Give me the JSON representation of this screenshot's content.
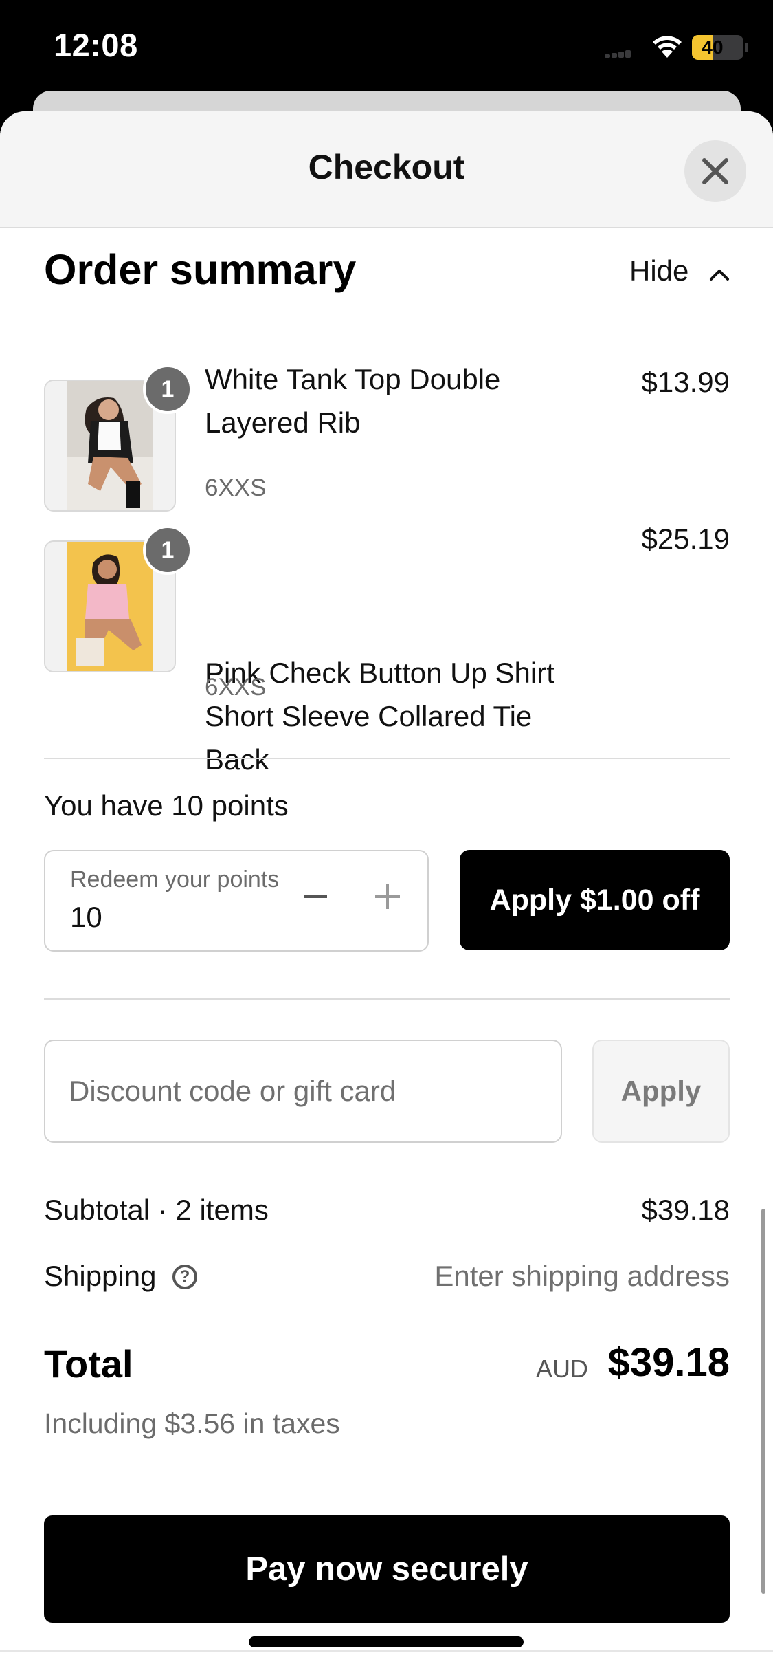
{
  "status_bar": {
    "time": "12:08",
    "battery_level": "40",
    "battery_percent": 40
  },
  "header": {
    "title": "Checkout"
  },
  "order_summary": {
    "title": "Order summary",
    "toggle_label": "Hide",
    "items": [
      {
        "quantity": "1",
        "name": "White Tank Top Double Layered Rib",
        "variant": "6XXS",
        "price": "$13.99"
      },
      {
        "quantity": "1",
        "name": "Pink Check Button Up Shirt Short Sleeve Collared Tie Back",
        "variant": "6XXS",
        "price": "$25.19"
      }
    ]
  },
  "points": {
    "text": "You have 10 points",
    "input_label": "Redeem your points",
    "input_value": "10",
    "apply_label": "Apply $1.00 off"
  },
  "discount": {
    "placeholder": "Discount code or gift card",
    "apply_label": "Apply"
  },
  "totals": {
    "subtotal_label": "Subtotal · 2 items",
    "subtotal_value": "$39.18",
    "shipping_label": "Shipping",
    "shipping_value": "Enter shipping address",
    "total_label": "Total",
    "currency": "AUD",
    "total_value": "$39.18",
    "taxes_note": "Including $3.56 in taxes"
  },
  "pay_button": {
    "label": "Pay now securely"
  },
  "colors": {
    "primary_button": "#000000",
    "badge": "#6b6b6b",
    "battery": "#f4c430"
  }
}
